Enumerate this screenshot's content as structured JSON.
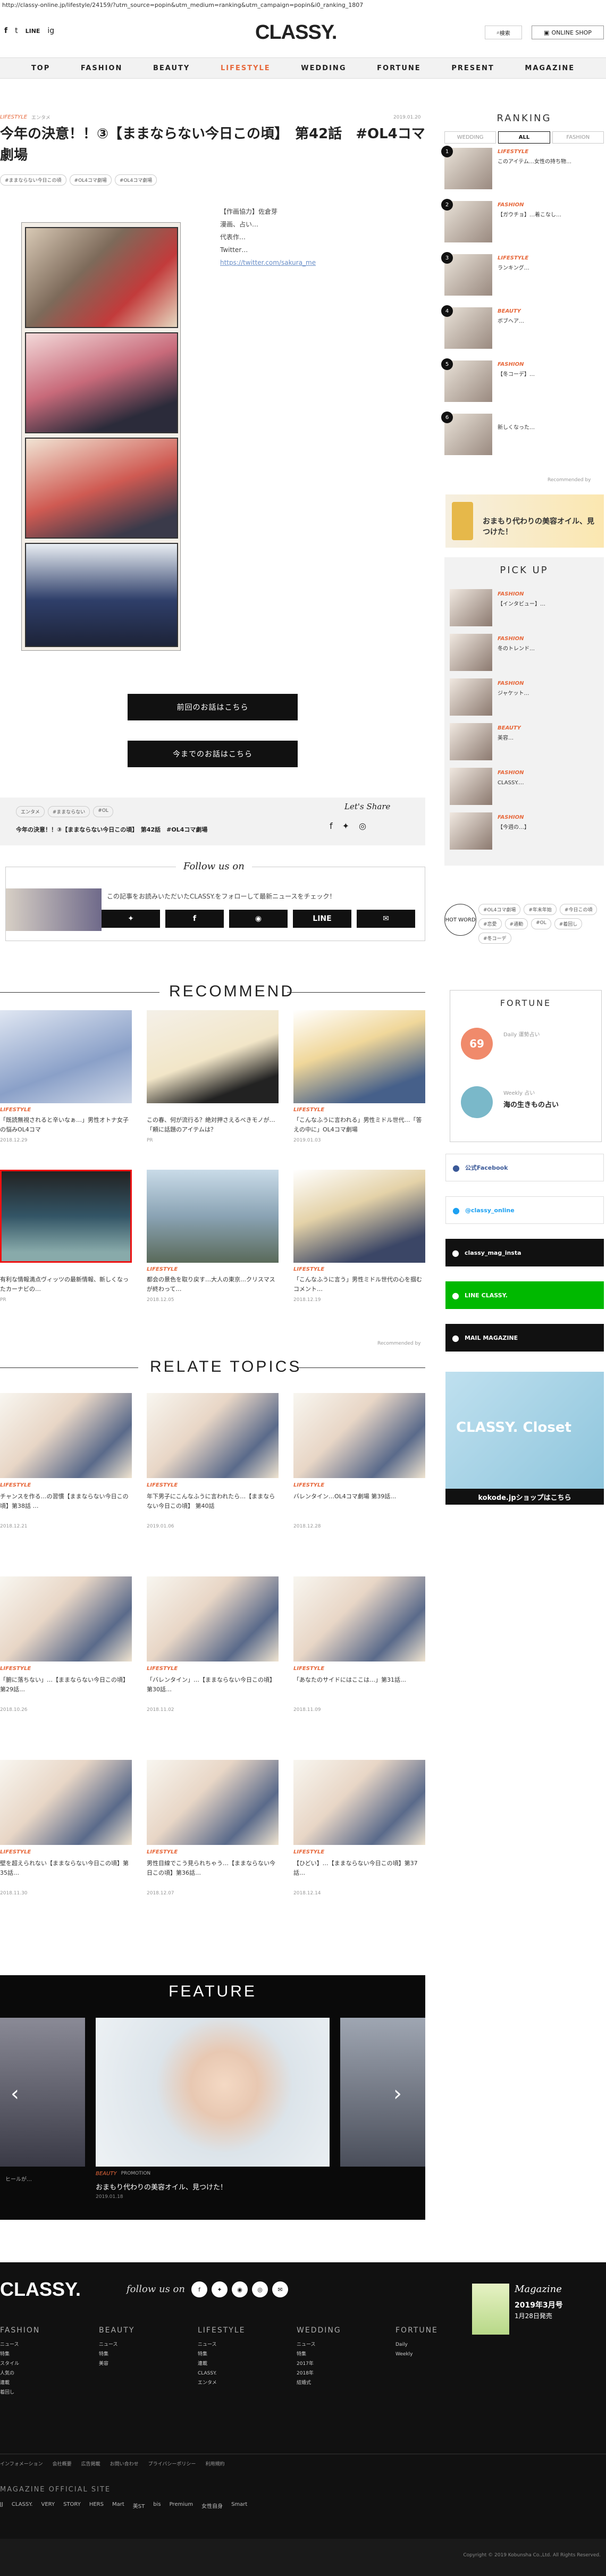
{
  "url": "http://classy-online.jp/lifestyle/24159/?utm_source=popin&utm_medium=ranking&utm_campaign=popin&i0_ranking_1807",
  "header": {
    "social": [
      "f",
      "t",
      "LINE",
      "ig"
    ],
    "logo": "CLASSY.",
    "search_label": "検索",
    "shop_label": "ONLINE SHOP"
  },
  "nav": [
    "TOP",
    "FASHION",
    "BEAUTY",
    "LIFESTYLE",
    "WEDDING",
    "FORTUNE",
    "PRESENT",
    "MAGAZINE"
  ],
  "article": {
    "category": "LIFESTYLE",
    "subcategory": "エンタメ",
    "date": "2019.01.20",
    "title": "今年の決意！！③【ままならない今日この頃】　第42話　#OL4コマ劇場",
    "tags": [
      "#ままならない今日この頃",
      "#OL4コマ劇場",
      "#OL4コマ劇場"
    ],
    "author_lines": [
      "【作画協力】佐倉芽",
      "漫画、占い…",
      "代表作…",
      "Twitter…"
    ],
    "author_link": "https://twitter.com/sakura_me",
    "btn_prev": "前回のお話はこちら",
    "btn_all": "今までのお話はこちら"
  },
  "share": {
    "chips": [
      "エンタメ",
      "#ままならない",
      "#OL"
    ],
    "title": "今年の決意！！③【ままならない今日この頃】　第42話　#OL4コマ劇場",
    "lets_share": "Let's Share"
  },
  "follow": {
    "heading": "Follow us on",
    "text": "この記事をお読みいただいたCLASSY.をフォローして最新ニュースをチェック！",
    "buttons": [
      "t",
      "f",
      "ig",
      "LINE",
      "mail"
    ]
  },
  "recommend": {
    "heading": "RECOMMEND",
    "items": [
      {
        "cat": "LIFESTYLE",
        "text": "「既読無視されると辛いなぁ…」男性オトナ女子の悩みOL4コマ",
        "date": "2018.12.29"
      },
      {
        "cat": "",
        "text": "この春、何が流行る？絶対押さえるべきモノが…「頼に話題のアイテムは？",
        "date": "PR"
      },
      {
        "cat": "LIFESTYLE",
        "text": "「こんなふうに言われる」男性ミドル世代…「答えの中に」OL4コマ劇場",
        "date": "2019.01.03"
      },
      {
        "cat": "",
        "text": "有利な情報満点ヴィッツの最新情報、新しくなったカーナビの…",
        "date": "PR"
      },
      {
        "cat": "LIFESTYLE",
        "text": "都会の景色を取り戻す…大人の東京…クリスマスが終わって…",
        "date": "2018.12.05"
      },
      {
        "cat": "LIFESTYLE",
        "text": "「こんなふうに言う」男性ミドル世代の心を掴むコメント…",
        "date": "2018.12.19"
      }
    ],
    "credit": "Recommended by"
  },
  "relate": {
    "heading": "RELATE TOPICS",
    "items": [
      {
        "cat": "LIFESTYLE",
        "text": "チャンスを作る…の習慣【ままならない今日この頃】第38話 …",
        "date": "2018.12.21"
      },
      {
        "cat": "LIFESTYLE",
        "text": "年下男子にこんなふうに言われたら…【ままならない今日この頃】 第40話",
        "date": "2019.01.06"
      },
      {
        "cat": "LIFESTYLE",
        "text": "バレンタイン…OL4コマ劇場 第39話…",
        "date": "2018.12.28"
      },
      {
        "cat": "LIFESTYLE",
        "text": "「腑に落ちない」…【ままならない今日この頃】第29話…",
        "date": "2018.10.26"
      },
      {
        "cat": "LIFESTYLE",
        "text": "「バレンタイン」…【ままならない今日この頃】第30話…",
        "date": "2018.11.02"
      },
      {
        "cat": "LIFESTYLE",
        "text": "「あなたのサイドにはここは…」第31話…",
        "date": "2018.11.09"
      },
      {
        "cat": "LIFESTYLE",
        "text": "壁を超えられない【ままならない今日この頃】第35話…",
        "date": "2018.11.30"
      },
      {
        "cat": "LIFESTYLE",
        "text": "男性目線でこう見られちゃう…【ままならない今日この頃】第36話…",
        "date": "2018.12.07"
      },
      {
        "cat": "LIFESTYLE",
        "text": "【ひどい】…【ままならない今日この頃】第37話…",
        "date": "2018.12.14"
      }
    ]
  },
  "feature": {
    "heading": "FEATURE",
    "cat": "BEAUTY",
    "sub": "PROMOTION",
    "caption": "おまもり代わりの美容オイル、見つけた！",
    "date": "2019.01.18",
    "left_caption": "ヒールが…"
  },
  "sidebar": {
    "ranking_heading": "RANKING",
    "tabs": [
      "WEDDING",
      "ALL",
      "FASHION"
    ],
    "ranking": [
      {
        "n": "1",
        "cat": "LIFESTYLE",
        "text": "このアイテム…女性の持ち物…"
      },
      {
        "n": "2",
        "cat": "FASHION",
        "text": "【ガウチョ】…着こなし…"
      },
      {
        "n": "3",
        "cat": "LIFESTYLE",
        "text": "ランキング…"
      },
      {
        "n": "4",
        "cat": "BEAUTY",
        "text": "ボブヘア…"
      },
      {
        "n": "5",
        "cat": "FASHION",
        "text": "【冬コーデ】…"
      },
      {
        "n": "6",
        "cat": "",
        "text": "新しくなった…"
      }
    ],
    "ranking_credit": "Recommended by",
    "ad_text": "おまもり代わりの美容オイル、見つけた！",
    "pickup_heading": "PICK UP",
    "pickup": [
      {
        "cat": "FASHION",
        "text": "【インタビュー】…"
      },
      {
        "cat": "FASHION",
        "text": "冬のトレンド…"
      },
      {
        "cat": "FASHION",
        "text": "ジャケット…"
      },
      {
        "cat": "BEAUTY",
        "text": "美容…"
      },
      {
        "cat": "FASHION",
        "text": "CLASSY.…"
      },
      {
        "cat": "FASHION",
        "text": "【今週の…】"
      }
    ],
    "hot_word": "HOT WORD",
    "hot_tags": [
      "#OL4コマ劇場",
      "#年末年始",
      "#今日この頃",
      "#恋愛",
      "#通勤",
      "#OL",
      "#着回し",
      "#冬コーデ"
    ],
    "fortune_heading": "FORTUNE",
    "fortune_daily": "Daily 運勢占い",
    "fortune_rank": "69",
    "fortune_weekly": "Weekly 占い",
    "fortune_sign": "海の生きもの占い",
    "sns": [
      {
        "label": "公式Facebook",
        "bg": "#ffffff",
        "fg": "#3b5998"
      },
      {
        "label": "@classy_online",
        "bg": "#ffffff",
        "fg": "#1da1f2"
      },
      {
        "label": "classy_mag_insta",
        "bg": "#111111",
        "fg": "#ffffff"
      },
      {
        "label": "LINE CLASSY.",
        "bg": "#00b900",
        "fg": "#ffffff"
      },
      {
        "label": "MAIL MAGAZINE",
        "bg": "#111111",
        "fg": "#ffffff"
      }
    ],
    "closet_text": "CLASSY. Closet",
    "closet_link": "kokode.jpショップはこちら"
  },
  "footer": {
    "logo": "CLASSY.",
    "follow": "follow us on",
    "columns": [
      {
        "title": "FASHION",
        "items": [
          "ニュース",
          "特集",
          "スタイル",
          "人気の",
          "連載",
          "着回し"
        ]
      },
      {
        "title": "BEAUTY",
        "items": [
          "ニュース",
          "特集",
          "美容"
        ]
      },
      {
        "title": "LIFESTYLE",
        "items": [
          "ニュース",
          "特集",
          "連載",
          "CLASSY.",
          "エンタメ"
        ]
      },
      {
        "title": "WEDDING",
        "items": [
          "ニュース",
          "特集",
          "2017年",
          "2018年",
          "結婚式"
        ]
      },
      {
        "title": "FORTUNE",
        "items": [
          "Daily",
          "Weekly"
        ]
      }
    ],
    "magazine": "Magazine",
    "issue": "2019年3月号",
    "issue_date": "1月28日発売",
    "magazine_site": "MAGAZINE OFFICIAL SITE",
    "links": [
      "インフォメーション",
      "会社概要",
      "広告掲載",
      "お問い合わせ",
      "プライバシーポリシー",
      "利用規約"
    ],
    "sites": [
      "JJ",
      "CLASSY.",
      "VERY",
      "STORY",
      "HERS",
      "Mart",
      "美ST",
      "bis",
      "Premium",
      "女性自身",
      "Smart"
    ],
    "copyright": "Copyright © 2019 Kobunsha Co.,Ltd. All Rights Reserved."
  }
}
